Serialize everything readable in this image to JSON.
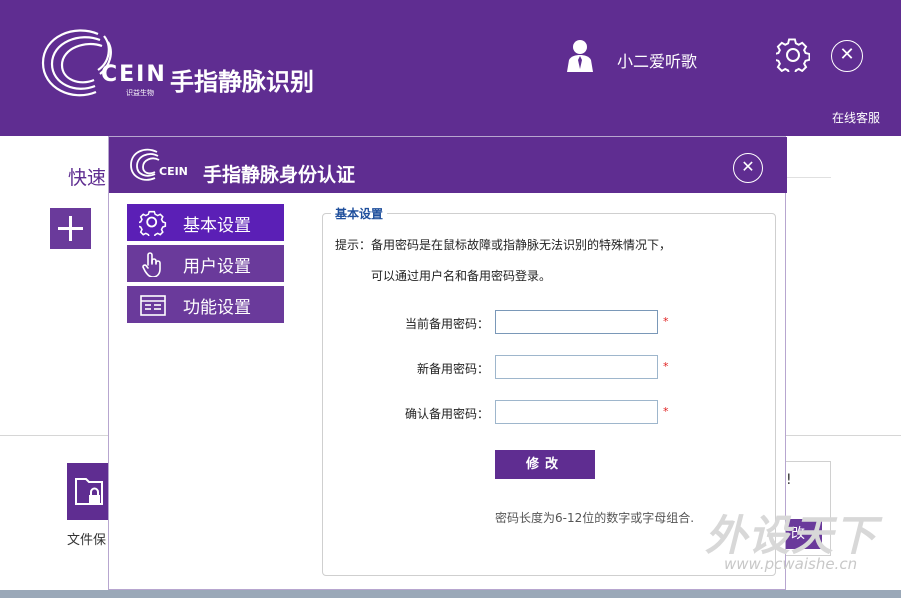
{
  "app": {
    "logo_text": "CEIN",
    "logo_subtext": "识益生物",
    "title": "手指静脉识别",
    "user_name": "小二爱听歌",
    "support_link": "在线客服"
  },
  "background": {
    "quick_label": "快速",
    "file_protect_label": "文件保",
    "card_excl": "!",
    "card_btn": "改"
  },
  "modal": {
    "logo_text": "CEIN",
    "title": "手指静脉身份认证",
    "sidebar": {
      "items": [
        {
          "label": "基本设置",
          "icon": "gear-icon",
          "active": true
        },
        {
          "label": "用户设置",
          "icon": "finger-touch-icon",
          "active": false
        },
        {
          "label": "功能设置",
          "icon": "window-icon",
          "active": false
        }
      ]
    },
    "panel": {
      "legend": "基本设置",
      "hint_line1": "提示：备用密码是在鼠标故障或指静脉无法识别的特殊情况下，",
      "hint_line2": "可以通过用户名和备用密码登录。",
      "fields": [
        {
          "label": "当前备用密码：",
          "value": "",
          "required": "*"
        },
        {
          "label": "新备用密码：",
          "value": "",
          "required": "*"
        },
        {
          "label": "确认备用密码：",
          "value": "",
          "required": "*"
        }
      ],
      "submit_label": "修改",
      "note": "密码长度为6-12位的数字或字母组合."
    }
  },
  "watermark": {
    "text": "外设天下",
    "url": "www.pcwaishe.cn"
  },
  "colors": {
    "brand_purple": "#5f2d91",
    "active_purple": "#5b1fb6",
    "legend_blue": "#1f4f9c",
    "required_red": "#e02020"
  }
}
